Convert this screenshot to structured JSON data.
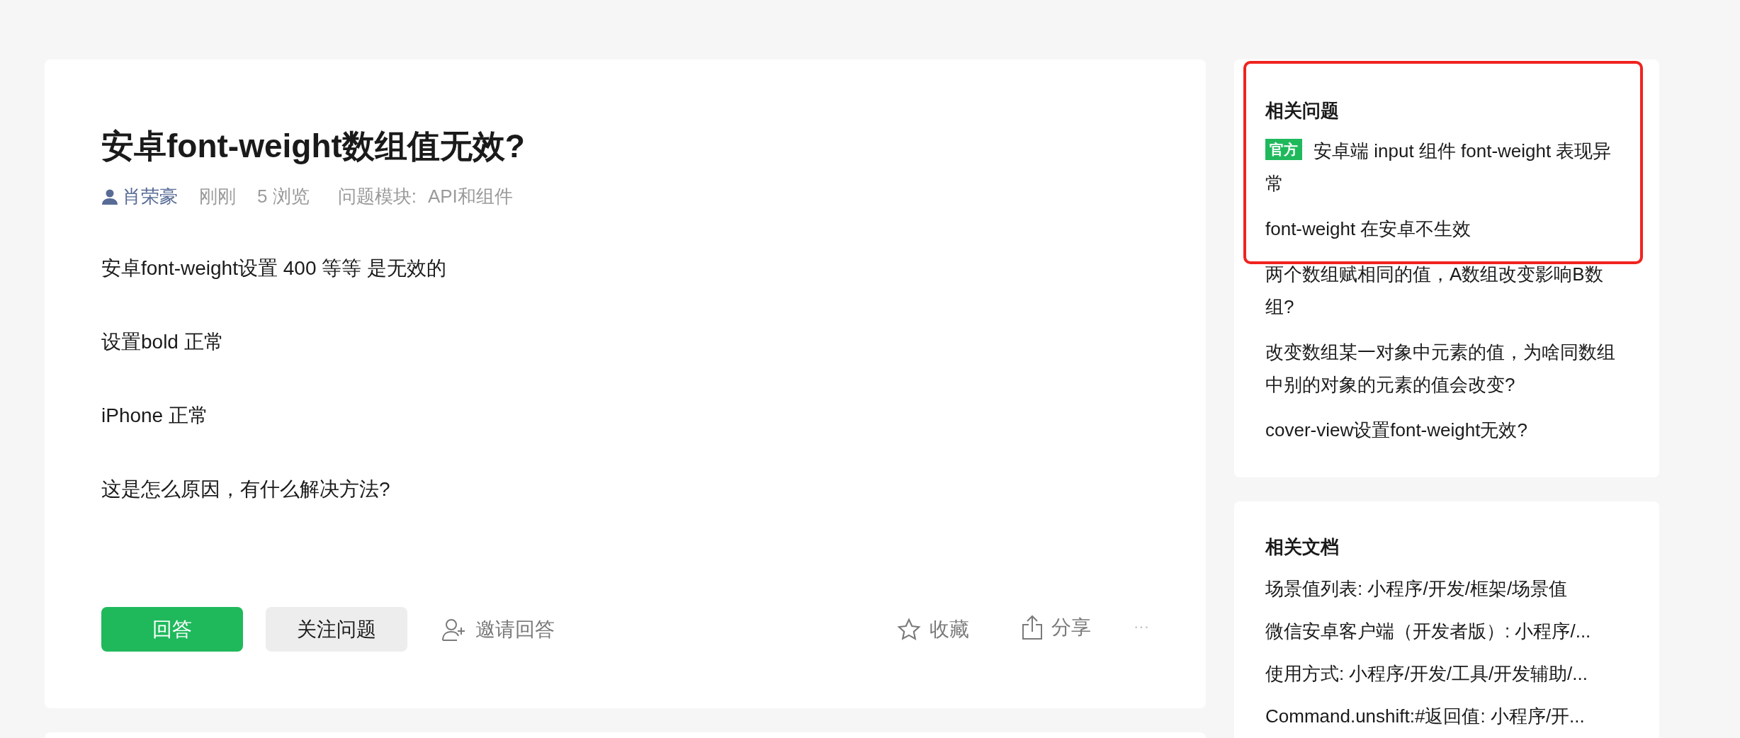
{
  "question": {
    "title": "安卓font-weight数组值无效?",
    "author": "肖荣豪",
    "time": "刚刚",
    "views": "5 浏览",
    "module_label": "问题模块:",
    "module": "API和组件",
    "body": [
      "安卓font-weight设置 400 等等 是无效的",
      "设置bold 正常",
      "iPhone 正常",
      "这是怎么原因，有什么解决方法?"
    ],
    "actions": {
      "answer": "回答",
      "follow": "关注问题",
      "invite": "邀请回答",
      "collect": "收藏",
      "share": "分享",
      "more": "···"
    }
  },
  "related_questions": {
    "title": "相关问题",
    "items": [
      {
        "badge": "官方",
        "text": "安卓端 input 组件 font-weight 表现异常"
      },
      {
        "text": "font-weight 在安卓不生效"
      },
      {
        "text": "两个数组赋相同的值，A数组改变影响B数组?"
      },
      {
        "text": "改变数组某一对象中元素的值，为啥同数组中别的对象的元素的值会改变?"
      },
      {
        "text": "cover-view设置font-weight无效?"
      }
    ]
  },
  "related_docs": {
    "title": "相关文档",
    "items": [
      "场景值列表: 小程序/开发/框架/场景值",
      "微信安卓客户端（开发者版）: 小程序/...",
      "使用方式: 小程序/开发/工具/开发辅助/...",
      "Command.unshift:#返回值: 小程序/开..."
    ]
  }
}
